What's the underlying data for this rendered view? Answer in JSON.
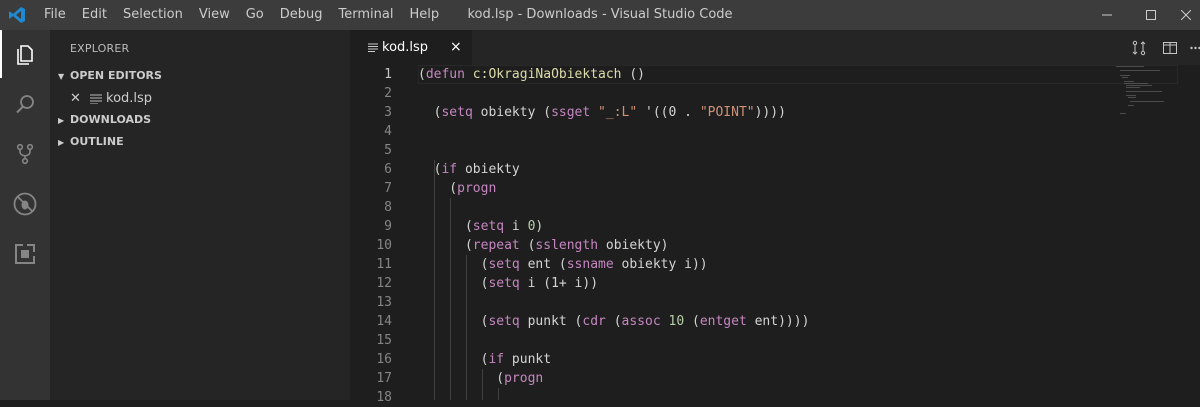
{
  "window": {
    "title": "kod.lsp - Downloads - Visual Studio Code"
  },
  "menu": [
    "File",
    "Edit",
    "Selection",
    "View",
    "Go",
    "Debug",
    "Terminal",
    "Help"
  ],
  "sidebar": {
    "title": "EXPLORER",
    "open_editors": "OPEN EDITORS",
    "open_file": "kod.lsp",
    "downloads": "DOWNLOADS",
    "outline": "OUTLINE"
  },
  "tab": {
    "label": "kod.lsp",
    "close": "×"
  },
  "editor": {
    "line_numbers": [
      "1",
      "2",
      "3",
      "4",
      "5",
      "6",
      "7",
      "8",
      "9",
      "10",
      "11",
      "12",
      "13",
      "14",
      "15",
      "16",
      "17",
      "18"
    ],
    "lines": [
      "(defun c:OkragiNaObiektach ()",
      "",
      "  (setq obiekty (ssget \"_:L\" '((0 . \"POINT\"))))",
      "",
      "",
      "  (if obiekty",
      "    (progn",
      "",
      "      (setq i 0)",
      "      (repeat (sslength obiekty)",
      "        (setq ent (ssname obiekty i))",
      "        (setq i (1+ i))",
      "",
      "        (setq punkt (cdr (assoc 10 (entget ent))))",
      "",
      "        (if punkt",
      "          (progn",
      ""
    ]
  },
  "colors": {
    "keyword": "#c586c0",
    "function": "#dcdcaa",
    "string": "#ce9178",
    "number": "#b5cea8",
    "paren": "#d4d4d4"
  }
}
